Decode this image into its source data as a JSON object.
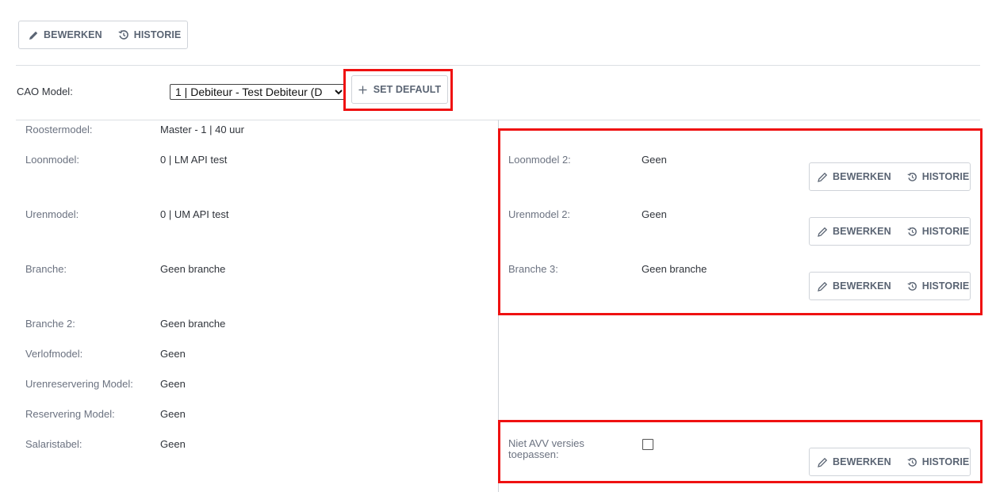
{
  "toolbar": {
    "edit_label": "BEWERKEN",
    "history_label": "HISTORIE"
  },
  "cao": {
    "label": "CAO Model:",
    "selected": "1 | Debiteur - Test Debiteur (D",
    "set_default_label": "SET DEFAULT"
  },
  "left_fields": [
    {
      "label": "Roostermodel:",
      "value": "Master - 1 | 40 uur"
    },
    {
      "label": "Loonmodel:",
      "value": "0 | LM API test"
    },
    {
      "label": "Urenmodel:",
      "value": "0 | UM API test"
    },
    {
      "label": "Branche:",
      "value": "Geen branche"
    },
    {
      "label": "Branche 2:",
      "value": "Geen branche"
    },
    {
      "label": "Verlofmodel:",
      "value": "Geen"
    },
    {
      "label": "Urenreservering Model:",
      "value": "Geen"
    },
    {
      "label": "Reservering Model:",
      "value": "Geen"
    },
    {
      "label": "Salaristabel:",
      "value": "Geen"
    }
  ],
  "right_fields": [
    {
      "label": "Loonmodel 2:",
      "value": "Geen",
      "edit_label": "BEWERKEN",
      "history_label": "HISTORIE"
    },
    {
      "label": "Urenmodel 2:",
      "value": "Geen",
      "edit_label": "BEWERKEN",
      "history_label": "HISTORIE"
    },
    {
      "label": "Branche 3:",
      "value": "Geen branche",
      "edit_label": "BEWERKEN",
      "history_label": "HISTORIE"
    }
  ],
  "avv": {
    "label_line1": "Niet AVV versies",
    "label_line2": "toepassen:",
    "checked": false,
    "edit_label": "BEWERKEN",
    "history_label": "HISTORIE"
  },
  "colors": {
    "highlight": "#ef1111",
    "button_text": "#5a6473",
    "border": "#cfd3d9"
  }
}
